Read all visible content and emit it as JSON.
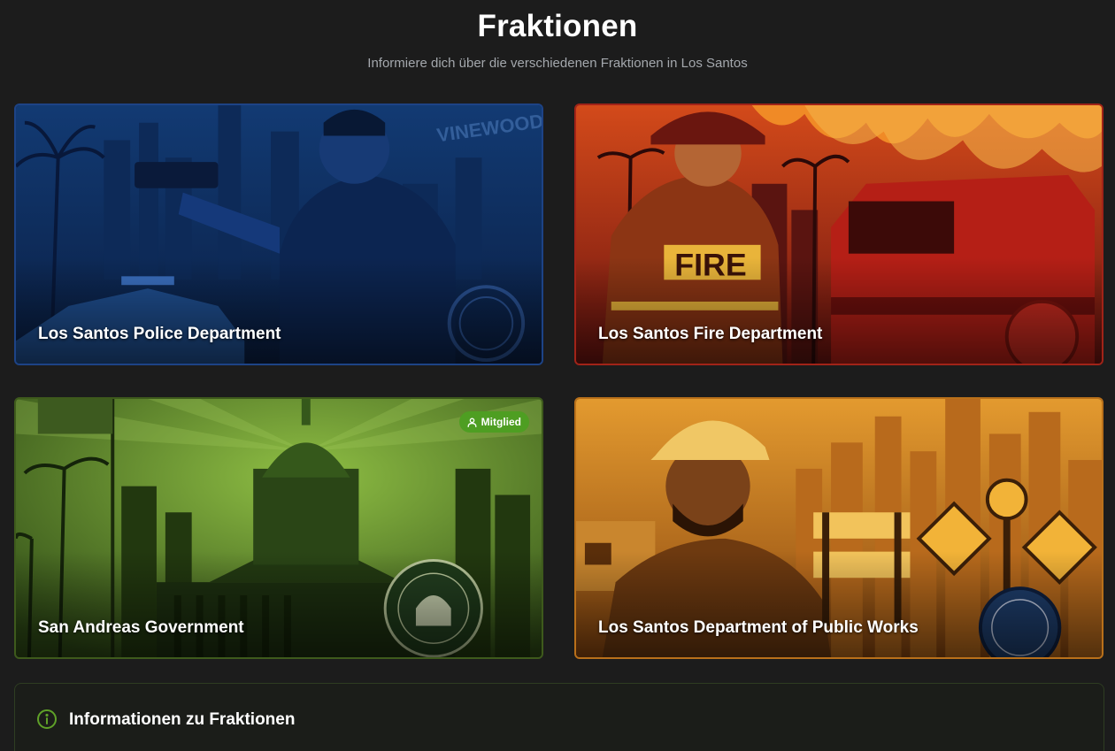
{
  "header": {
    "title": "Fraktionen",
    "subtitle": "Informiere dich über die verschiedenen Fraktionen in Los Santos"
  },
  "factions": [
    {
      "name": "Los Santos Police Department",
      "accent": "#1d4386",
      "icon": "police-art",
      "member": false
    },
    {
      "name": "Los Santos Fire Department",
      "accent": "#a12318",
      "icon": "fire-art",
      "member": false
    },
    {
      "name": "San Andreas Government",
      "accent": "#3e5a1c",
      "icon": "government-art",
      "member": true,
      "badge_label": "Mitglied"
    },
    {
      "name": "Los Santos Department of Public Works",
      "accent": "#b9701a",
      "icon": "public-works-art",
      "member": false
    }
  ],
  "info": {
    "title": "Informationen zu Fraktionen",
    "icon": "info-circle-icon",
    "accent": "#5fa128"
  }
}
